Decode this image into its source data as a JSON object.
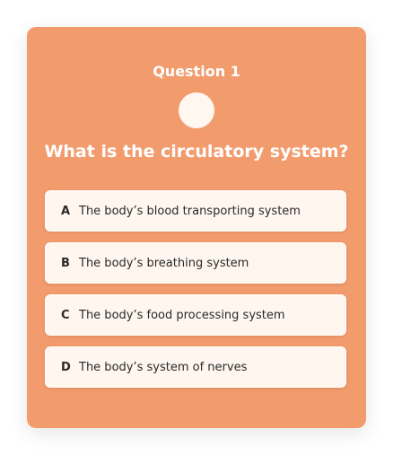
{
  "quiz": {
    "question_label": "Question 1",
    "question_text": "What is the circulatory system?",
    "options": [
      {
        "letter": "A",
        "text": "The body’s blood transporting system"
      },
      {
        "letter": "B",
        "text": "The body’s breathing system"
      },
      {
        "letter": "C",
        "text": "The body’s food processing system"
      },
      {
        "letter": "D",
        "text": "The body’s system of nerves"
      }
    ]
  },
  "colors": {
    "card_background": "#f29c6e",
    "option_background": "#fff6ef",
    "text": "#2a2a2a"
  }
}
